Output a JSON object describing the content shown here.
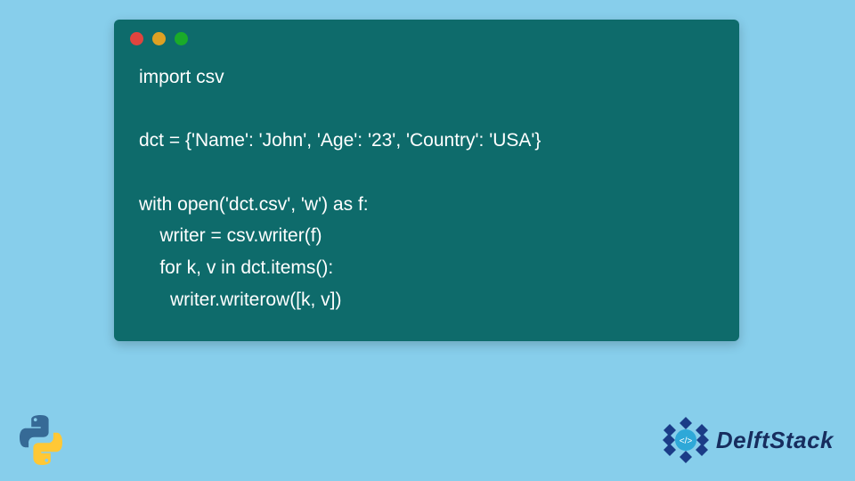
{
  "code": {
    "line1": "import csv",
    "line2": "",
    "line3": "dct = {'Name': 'John', 'Age': '23', 'Country': 'USA'}",
    "line4": "",
    "line5": "with open('dct.csv', 'w') as f:",
    "line6": "    writer = csv.writer(f)",
    "line7": "    for k, v in dct.items():",
    "line8": "      writer.writerow([k, v])"
  },
  "brand": {
    "name": "DelftStack"
  }
}
